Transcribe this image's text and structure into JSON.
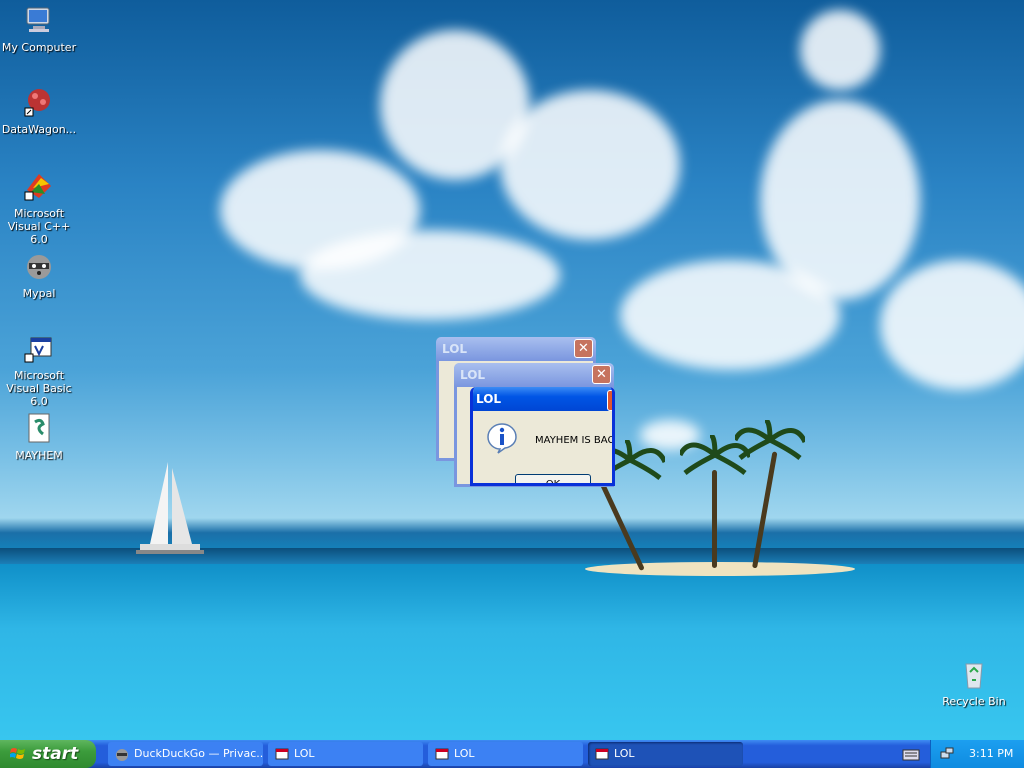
{
  "desktop_icons": [
    {
      "label": "My Computer"
    },
    {
      "label": "DataWagon..."
    },
    {
      "label": "Microsoft Visual C++ 6.0"
    },
    {
      "label": "Mypal"
    },
    {
      "label": "Microsoft Visual Basic 6.0"
    },
    {
      "label": "MAYHEM"
    },
    {
      "label": "Recycle Bin"
    }
  ],
  "windows": [
    {
      "title": "LOL",
      "close": "✕"
    },
    {
      "title": "LOL",
      "close": "✕"
    },
    {
      "title": "LOL",
      "message": "MAYHEM IS BAC",
      "ok": "OK"
    }
  ],
  "taskbar": {
    "start": "start",
    "buttons": [
      {
        "label": "DuckDuckGo — Privac..."
      },
      {
        "label": "LOL"
      },
      {
        "label": "LOL"
      },
      {
        "label": "LOL"
      }
    ],
    "clock": "3:11 PM"
  }
}
